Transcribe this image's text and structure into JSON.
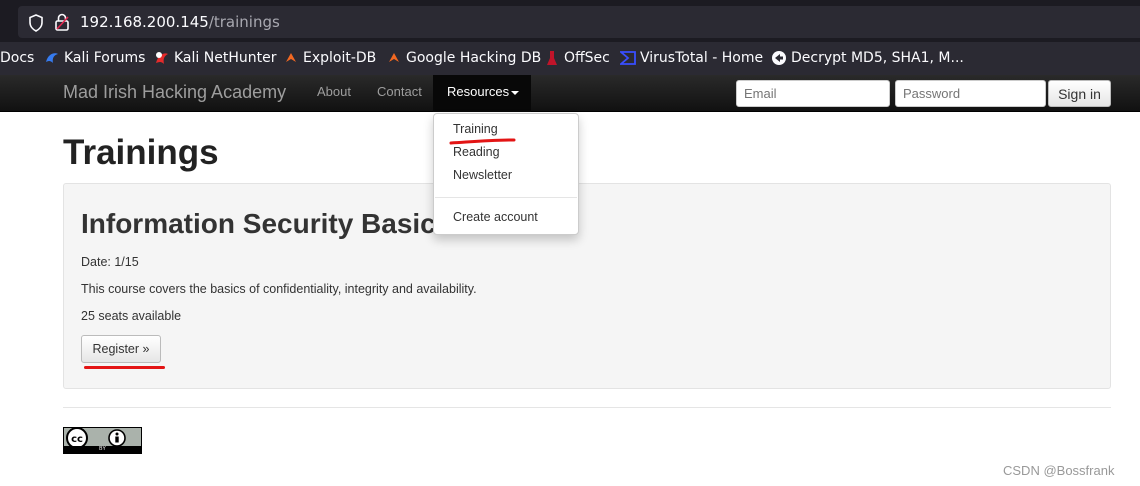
{
  "browser": {
    "url_host": "192.168.200.145",
    "url_path": "/trainings"
  },
  "bookmarks": [
    {
      "label": "Docs",
      "icon": "none"
    },
    {
      "label": "Kali Forums",
      "icon": "kali-dragon-icon"
    },
    {
      "label": "Kali NetHunter",
      "icon": "nethunter-icon"
    },
    {
      "label": "Exploit-DB",
      "icon": "exploit-db-icon"
    },
    {
      "label": "Google Hacking DB",
      "icon": "ghdb-icon"
    },
    {
      "label": "OffSec",
      "icon": "offsec-icon"
    },
    {
      "label": "VirusTotal - Home",
      "icon": "virustotal-icon"
    },
    {
      "label": "Decrypt MD5, SHA1, M...",
      "icon": "decrypt-icon"
    }
  ],
  "navbar": {
    "brand": "Mad Irish Hacking Academy",
    "links": [
      "About",
      "Contact"
    ],
    "resources": "Resources",
    "email_placeholder": "Email",
    "password_placeholder": "Password",
    "signin": "Sign in"
  },
  "dropdown": {
    "items": [
      "Training",
      "Reading",
      "Newsletter"
    ],
    "extra": "Create account"
  },
  "page": {
    "title": "Trainings",
    "course": {
      "title": "Information Security Basics",
      "date": "Date: 1/15",
      "description": "This course covers the basics of confidentiality, integrity and availability.",
      "seats": "25 seats available",
      "register": "Register »"
    }
  },
  "footer": {
    "license_text": "BY",
    "watermark": "CSDN @Bossfrank"
  },
  "colors": {
    "annotation_red": "#e31414",
    "navbar_dark": "#111111",
    "browser_bg": "#2b2a33"
  }
}
